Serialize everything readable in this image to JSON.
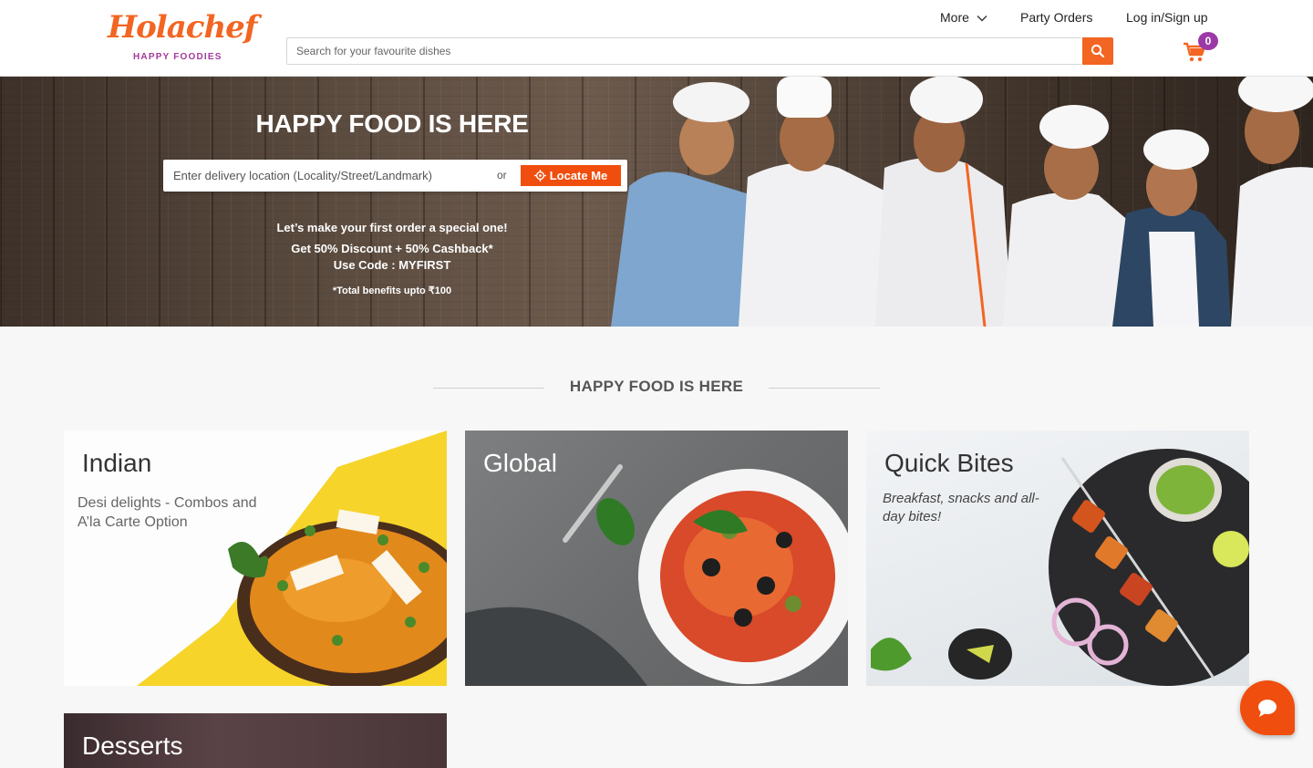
{
  "header": {
    "logo": {
      "script": "Holachef",
      "tagline": "HAPPY FOODIES"
    },
    "search": {
      "placeholder": "Search for your favourite dishes",
      "button_icon": "search-icon"
    },
    "nav": {
      "more": "More",
      "party_orders": "Party Orders",
      "login": "Log in/Sign up"
    },
    "cart": {
      "icon": "cart-icon",
      "count": "0"
    }
  },
  "hero": {
    "title": "HAPPY FOOD IS HERE",
    "location_placeholder": "Enter delivery location (Locality/Street/Landmark)",
    "or": "or",
    "locate_button": "Locate Me",
    "promo_line1": "Let’s make your first order a special one!",
    "promo_line2": "Get 50% Discount + 50% Cashback*",
    "promo_line3": "Use Code : MYFIRST",
    "promo_note": "*Total benefits upto ₹100"
  },
  "section": {
    "title": "HAPPY FOOD IS HERE"
  },
  "categories": [
    {
      "title": "Indian",
      "subtitle": "Desi delights - Combos and A’la Carte Option"
    },
    {
      "title": "Global",
      "subtitle": ""
    },
    {
      "title": "Quick Bites",
      "subtitle": "Breakfast, snacks and all-day bites!"
    },
    {
      "title": "Desserts",
      "subtitle": ""
    }
  ],
  "colors": {
    "brand_orange": "#f26522",
    "cart_badge": "#9b3aa6",
    "chat_button": "#f04e0e"
  },
  "chat": {
    "icon": "chat-bubble-icon"
  }
}
